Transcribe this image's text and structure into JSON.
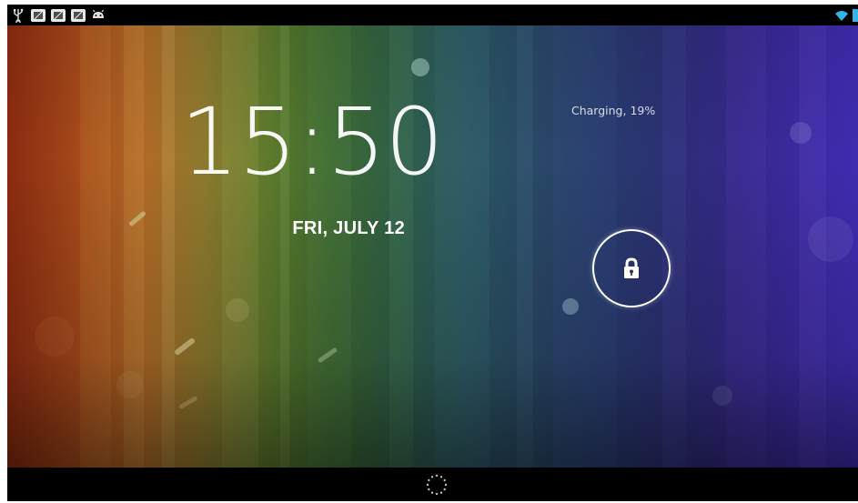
{
  "status_bar": {
    "left_icons": [
      "usb-icon",
      "notification-icon",
      "notification-icon",
      "notification-icon",
      "android-debug-icon"
    ],
    "right_icons": [
      "wifi-icon",
      "battery-charging-icon"
    ]
  },
  "lock_screen": {
    "time": "15:50",
    "date": "FRI, JULY 12",
    "charging_status": "Charging, 19%",
    "unlock_icon": "lock-icon"
  },
  "nav_bar": {
    "center_icon": "loading-spinner-icon"
  },
  "colors": {
    "status_bar_bg": "#000000",
    "text": "#ffffff",
    "wifi": "#33b5e5"
  }
}
